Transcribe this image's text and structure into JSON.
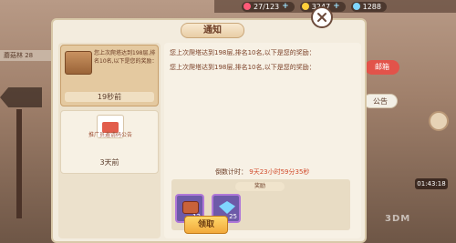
{
  "background": {
    "left_banner": "蘑菇林 28"
  },
  "hud": {
    "hearts": "27/123",
    "coins": "3247",
    "gems": "1288"
  },
  "side": {
    "mail_label": "邮箱",
    "notice_label": "公告",
    "timer": "01:43:18"
  },
  "watermark": "3DM",
  "dialog": {
    "title": "通知",
    "notices": [
      {
        "text": "您上次爬塔达到198层,排名10名,以下是您的奖励：",
        "time": "19秒前",
        "icon": "gift-box-icon",
        "selected": true
      },
      {
        "text": "推广员邀请码公告",
        "time": "3天前",
        "icon": "red-envelope-icon",
        "selected": false
      }
    ],
    "message": {
      "line1": "您上次爬塔达到198层,排名10名,以下是您的奖励：",
      "line2": "您上次爬塔达到198层,排名10名,以下是您的奖励：",
      "countdown_label": "倒数计时：",
      "countdown_value": "9天23小时59分35秒",
      "reward_title": "奖励",
      "rewards": [
        {
          "icon": "chest-icon",
          "count": "12"
        },
        {
          "icon": "gem-icon",
          "count": "25"
        }
      ]
    },
    "confirm_label": "领取"
  },
  "colors": {
    "accent_red": "#e2534a",
    "countdown_red": "#d14a2b",
    "panel_bg": "#f3ecde",
    "reward_border": "#b078d8"
  }
}
